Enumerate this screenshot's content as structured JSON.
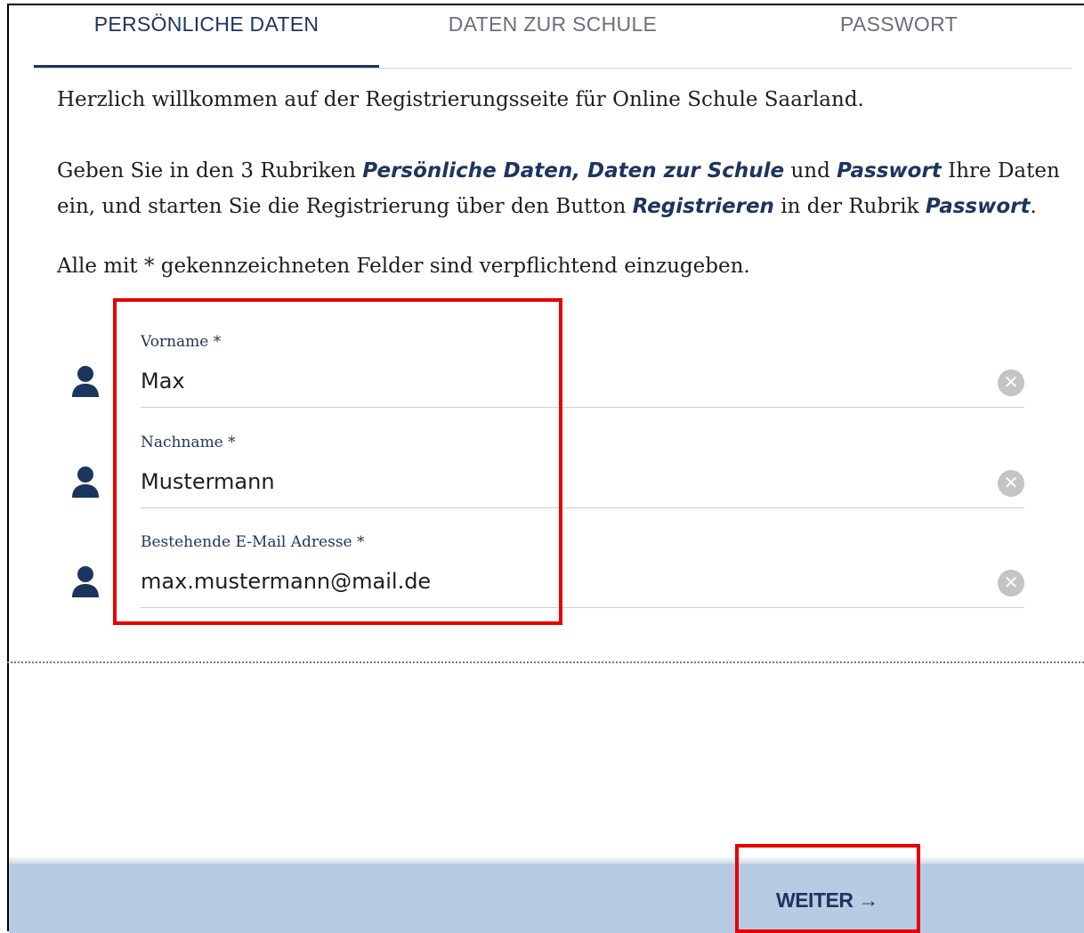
{
  "tabs": [
    {
      "label": "PERSÖNLICHE DATEN",
      "active": true
    },
    {
      "label": "DATEN ZUR SCHULE",
      "active": false
    },
    {
      "label": "PASSWORT",
      "active": false
    }
  ],
  "intro": {
    "welcome": "Herzlich willkommen auf der Registrierungsseite für Online Schule Saarland.",
    "line2": {
      "p1": "Geben Sie in den 3 Rubriken ",
      "em1": "Persönliche Daten, Daten zur Schule",
      "p2": " und ",
      "em2": "Passwort",
      "p3": " Ihre Daten"
    },
    "line3": {
      "p1": "ein, und starten Sie die Registrierung über den Button ",
      "em1": "Registrieren",
      "p2": " in der Rubrik ",
      "em2": "Passwort",
      "p3": "."
    },
    "required_note": "Alle mit * gekennzeichneten Felder sind verpflichtend einzugeben."
  },
  "fields": [
    {
      "label": "Vorname *",
      "value": "Max",
      "icon": "person-icon"
    },
    {
      "label": "Nachname *",
      "value": "Mustermann",
      "icon": "person-icon"
    },
    {
      "label": "Bestehende E-Mail Adresse *",
      "value": "max.mustermann@mail.de",
      "icon": "person-icon"
    }
  ],
  "clear_glyph": "✕",
  "footer": {
    "next_label": "WEITER",
    "next_arrow": "→"
  },
  "colors": {
    "primary": "#1c355e",
    "footer_bg": "#b7cce3",
    "highlight": "#e60000"
  }
}
